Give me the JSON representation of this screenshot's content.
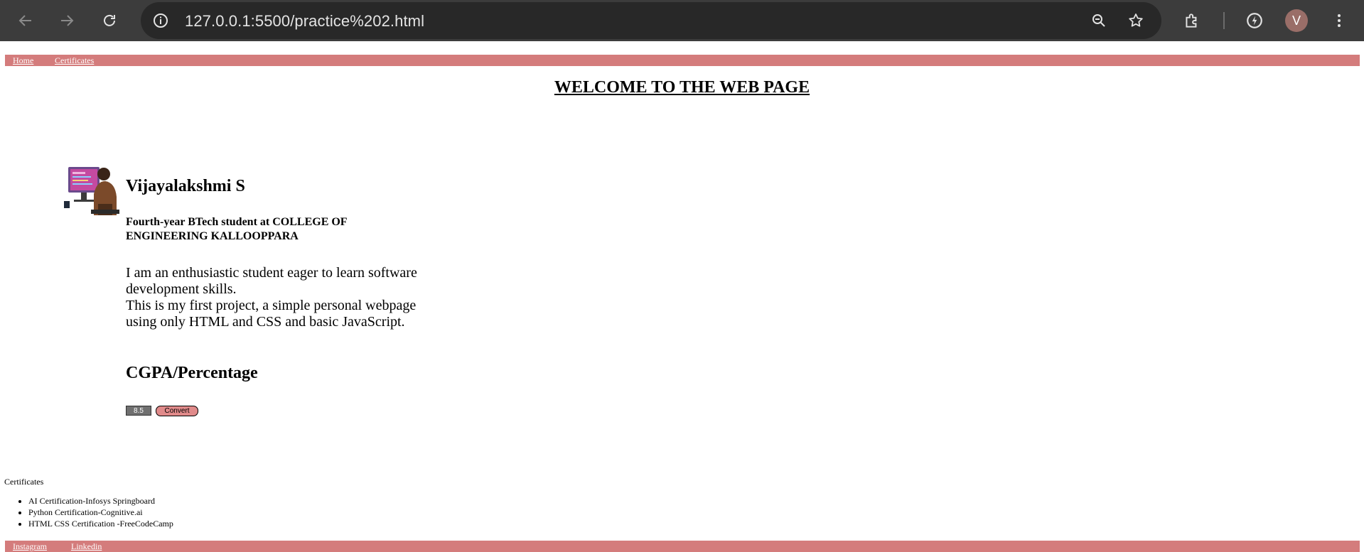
{
  "browser": {
    "url": "127.0.0.1:5500/practice%202.html",
    "avatar_letter": "V",
    "icons": [
      "back-icon",
      "forward-icon",
      "reload-icon",
      "site-info-icon",
      "zoom-icon",
      "bookmark-star-icon",
      "extensions-icon",
      "performance-icon",
      "menu-icon"
    ]
  },
  "topnav": {
    "links": [
      "Home",
      "Certificates"
    ]
  },
  "page": {
    "welcome": "WELCOME TO THE WEB PAGE",
    "name": "Vijayalakshmi S",
    "subtitle": "Fourth-year BTech student at COLLEGE OF ENGINEERING KALLOOPPARA",
    "about_line1": "I am an enthusiastic student eager to learn software development skills.",
    "about_line2": "This is my first project, a simple personal webpage using only HTML and CSS and basic JavaScript.",
    "cgpa_heading": "CGPA/Percentage",
    "cgpa_value": "8.5",
    "convert_label": "Convert"
  },
  "certificates": {
    "heading": "Certificates",
    "items": [
      "AI Certification-Infosys Springboard",
      "Python Certification-Cognitive.ai",
      "HTML CSS Certification -FreeCodeCamp"
    ]
  },
  "footer": {
    "links": [
      "Instagram",
      "Linkedin"
    ]
  },
  "colors": {
    "nav_bg": "#d47c7c",
    "chrome_bg": "#3c3c3c",
    "omnibox_bg": "#282828",
    "button_bg": "#e08a8a"
  }
}
